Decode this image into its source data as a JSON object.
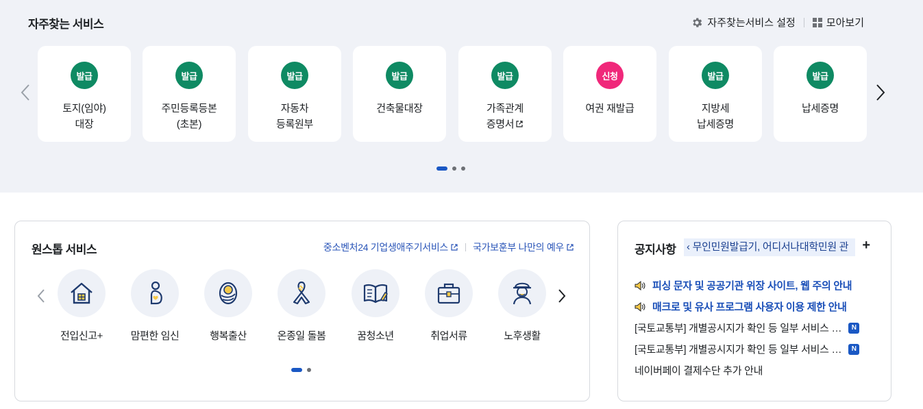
{
  "frequent": {
    "title": "자주찾는 서비스",
    "settings_label": "자주찾는서비스 설정",
    "viewall_label": "모아보기",
    "cards": [
      {
        "badge": "발급",
        "line1": "토지(임야)",
        "line2": "대장",
        "badge_color": "#0f8a63"
      },
      {
        "badge": "발급",
        "line1": "주민등록등본",
        "line2": "(초본)",
        "badge_color": "#0f8a63"
      },
      {
        "badge": "발급",
        "line1": "자동차",
        "line2": "등록원부",
        "badge_color": "#0f8a63"
      },
      {
        "badge": "발급",
        "line1": "건축물대장",
        "line2": "",
        "badge_color": "#0f8a63"
      },
      {
        "badge": "발급",
        "line1": "가족관계",
        "line2": "증명서",
        "badge_color": "#0f8a63"
      },
      {
        "badge": "신청",
        "line1": "여권 재발급",
        "line2": "",
        "badge_color": "#f0287a"
      },
      {
        "badge": "발급",
        "line1": "지방세",
        "line2": "납세증명",
        "badge_color": "#0f8a63"
      },
      {
        "badge": "발급",
        "line1": "납세증명",
        "line2": "",
        "badge_color": "#0f8a63"
      }
    ]
  },
  "onestop": {
    "title": "원스톱 서비스",
    "link1": "중소벤처24 기업생애주기서비스",
    "link2": "국가보훈부 나만의 예우",
    "items": [
      {
        "label": "전입신고+",
        "icon": "house-icon"
      },
      {
        "label": "맘편한 임신",
        "icon": "pregnancy-icon"
      },
      {
        "label": "행복출산",
        "icon": "baby-icon"
      },
      {
        "label": "온종일 돌봄",
        "icon": "ribbon-icon"
      },
      {
        "label": "꿈청소년",
        "icon": "book-icon"
      },
      {
        "label": "취업서류",
        "icon": "briefcase-icon"
      },
      {
        "label": "노후생활",
        "icon": "elder-icon"
      }
    ]
  },
  "notice": {
    "title": "공지사항",
    "ticker": "무인민원발급기, 어디서나대학민원 관",
    "highlights": [
      "피싱 문자 및 공공기관 위장 사이트, 웹 주의 안내",
      "매크로 및 유사 프로그램 사용자 이용 제한 안내"
    ],
    "items": [
      {
        "text": "[국토교통부] 개별공시지가 확인 등 일부 서비스 …",
        "badge": "N"
      },
      {
        "text": "[국토교통부] 개별공시지가 확인 등 일부 서비스 …",
        "badge": "N"
      },
      {
        "text": "네이버페이 결제수단 추가 안내",
        "badge": ""
      }
    ]
  },
  "colors": {
    "accent": "#1a58c4",
    "issue_green": "#0f8a63",
    "apply_pink": "#f0287a",
    "band_bg": "#f0f2f7"
  }
}
